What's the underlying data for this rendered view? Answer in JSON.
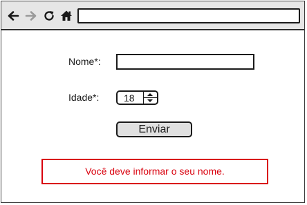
{
  "browser": {
    "address_value": "",
    "icons": [
      "back-arrow-icon",
      "forward-arrow-icon",
      "reload-icon",
      "home-icon"
    ]
  },
  "form": {
    "name_label": "Nome*:",
    "name_value": "",
    "age_label": "Idade*:",
    "age_value": "18",
    "submit_label": "Enviar"
  },
  "error": {
    "message": "Você deve informar o seu nome.",
    "color": "#d9000d"
  }
}
